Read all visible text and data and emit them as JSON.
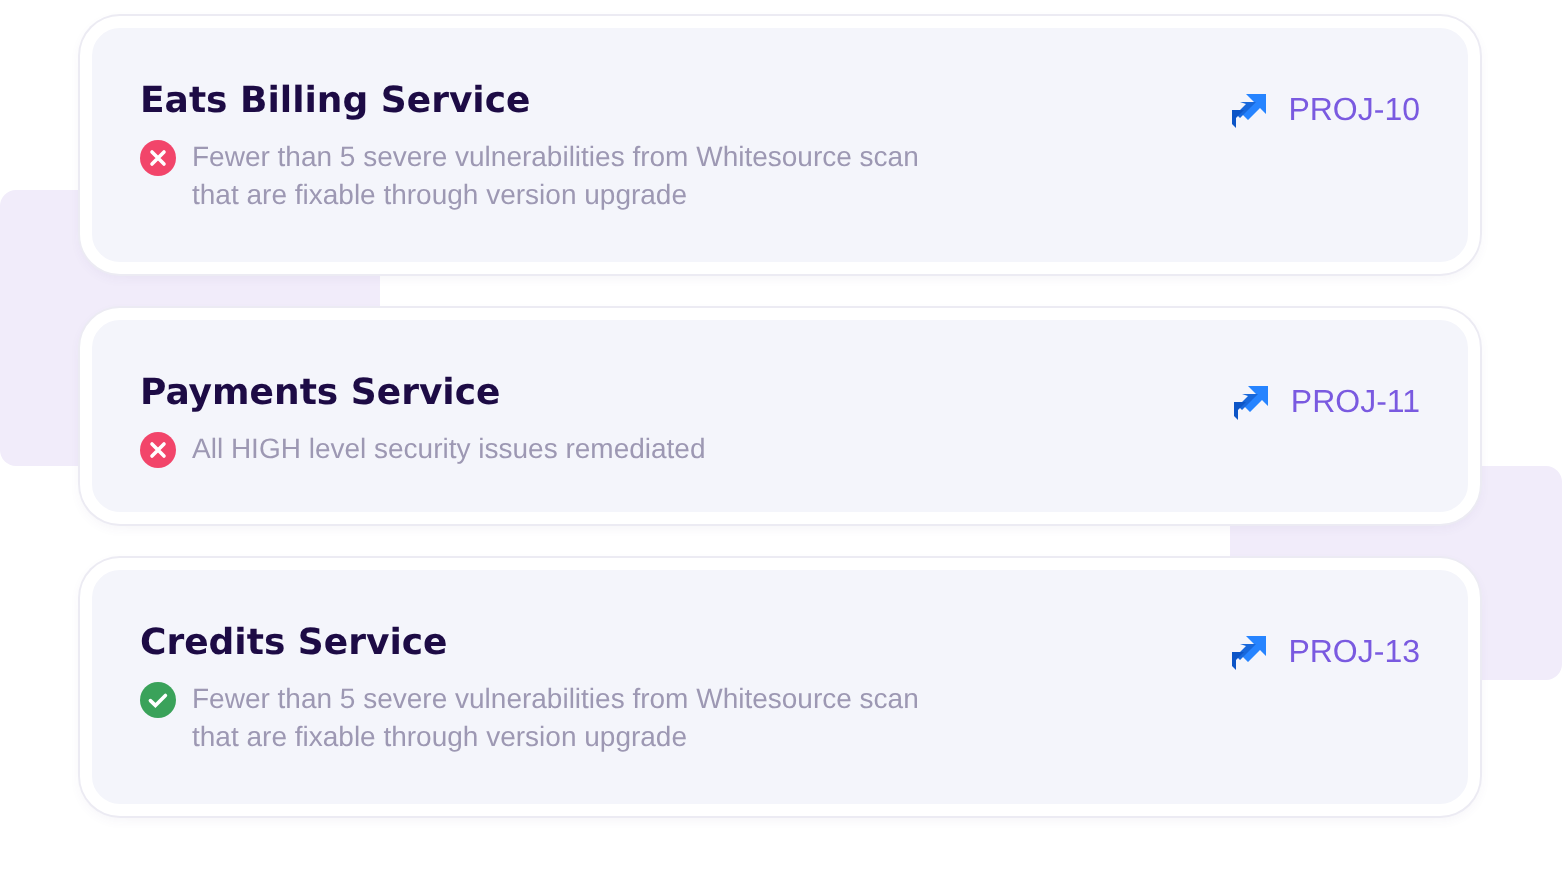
{
  "services": [
    {
      "name": "Eats Billing Service",
      "passed": false,
      "check": "Fewer than 5 severe vulnerabilities from Whitesource scan\nthat are fixable through version upgrade",
      "ticket": "PROJ-10"
    },
    {
      "name": "Payments Service",
      "passed": false,
      "check": "All HIGH level security issues remediated",
      "ticket": "PROJ-11"
    },
    {
      "name": "Credits Service",
      "passed": true,
      "check": "Fewer than 5 severe vulnerabilities from Whitesource scan\nthat are fixable through version upgrade",
      "ticket": "PROJ-13"
    }
  ]
}
